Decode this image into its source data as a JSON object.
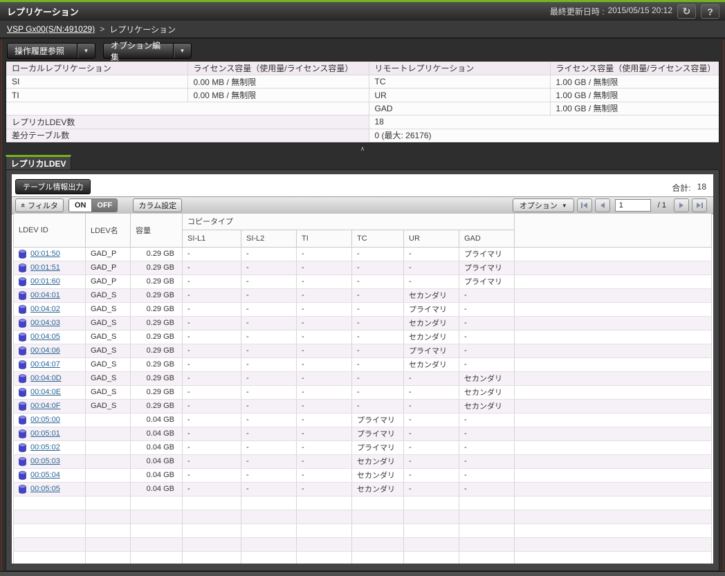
{
  "colors": {
    "accent_green": "#74b41e",
    "link_blue": "#2a6496",
    "alt_row": "#f6f1f6",
    "frame_maroon": "#553028"
  },
  "icons": {
    "refresh": "↻",
    "help": "?",
    "dropdown": "▼",
    "collapse": "∧",
    "filter": "«"
  },
  "header": {
    "title": "レプリケーション",
    "last_updated_label": "最終更新日時 :",
    "last_updated": "2015/05/15 20:12"
  },
  "breadcrumb": {
    "root": "VSP Gx00(S/N:491029)",
    "separator": ">",
    "current": "レプリケーション"
  },
  "actions": {
    "history_button": "操作履歴参照",
    "options_button": "オプション編集"
  },
  "summary": {
    "local_header": "ローカルレプリケーション",
    "local_license_header": "ライセンス容量（使用量/ライセンス容量）",
    "local_rows": [
      {
        "name": "SI",
        "license": "0.00 MB / 無制限"
      },
      {
        "name": "TI",
        "license": "0.00 MB / 無制限"
      }
    ],
    "remote_header": "リモートレプリケーション",
    "remote_license_header": "ライセンス容量（使用量/ライセンス容量）",
    "remote_rows": [
      {
        "name": "TC",
        "license": "1.00 GB / 無制限"
      },
      {
        "name": "UR",
        "license": "1.00 GB / 無制限"
      },
      {
        "name": "GAD",
        "license": "1.00 GB / 無制限"
      }
    ],
    "replica_ldev_label": "レプリカLDEV数",
    "replica_ldev_count": "18",
    "diff_table_label": "差分テーブル数",
    "diff_table_value": "0 (最大: 26176)"
  },
  "tab": {
    "label": "レプリカLDEV"
  },
  "table_panel": {
    "export_button": "テーブル情報出力",
    "total_label": "合計:",
    "total_value": "18",
    "filter_label": "フィルタ",
    "on_label": "ON",
    "off_label": "OFF",
    "column_settings_label": "カラム設定",
    "option_button": "オプション",
    "page": "1",
    "page_total": "/ 1"
  },
  "table": {
    "headers": {
      "ldev_id": "LDEV ID",
      "ldev_name": "LDEV名",
      "capacity": "容量",
      "copy_type_group": "コピータイプ",
      "sub": [
        "SI-L1",
        "SI-L2",
        "TI",
        "TC",
        "UR",
        "GAD"
      ]
    },
    "filler_rows": 5,
    "rows": [
      {
        "id": "00:01:50",
        "name": "GAD_P",
        "capacity": "0.29 GB",
        "copy": [
          "-",
          "-",
          "-",
          "-",
          "-",
          "プライマリ"
        ]
      },
      {
        "id": "00:01:51",
        "name": "GAD_P",
        "capacity": "0.29 GB",
        "copy": [
          "-",
          "-",
          "-",
          "-",
          "-",
          "プライマリ"
        ]
      },
      {
        "id": "00:01:60",
        "name": "GAD_P",
        "capacity": "0.29 GB",
        "copy": [
          "-",
          "-",
          "-",
          "-",
          "-",
          "プライマリ"
        ]
      },
      {
        "id": "00:04:01",
        "name": "GAD_S",
        "capacity": "0.29 GB",
        "copy": [
          "-",
          "-",
          "-",
          "-",
          "セカンダリ",
          "-"
        ]
      },
      {
        "id": "00:04:02",
        "name": "GAD_S",
        "capacity": "0.29 GB",
        "copy": [
          "-",
          "-",
          "-",
          "-",
          "プライマリ",
          "-"
        ]
      },
      {
        "id": "00:04:03",
        "name": "GAD_S",
        "capacity": "0.29 GB",
        "copy": [
          "-",
          "-",
          "-",
          "-",
          "セカンダリ",
          "-"
        ]
      },
      {
        "id": "00:04:05",
        "name": "GAD_S",
        "capacity": "0.29 GB",
        "copy": [
          "-",
          "-",
          "-",
          "-",
          "セカンダリ",
          "-"
        ]
      },
      {
        "id": "00:04:06",
        "name": "GAD_S",
        "capacity": "0.29 GB",
        "copy": [
          "-",
          "-",
          "-",
          "-",
          "プライマリ",
          "-"
        ]
      },
      {
        "id": "00:04:07",
        "name": "GAD_S",
        "capacity": "0.29 GB",
        "copy": [
          "-",
          "-",
          "-",
          "-",
          "セカンダリ",
          "-"
        ]
      },
      {
        "id": "00:04:0D",
        "name": "GAD_S",
        "capacity": "0.29 GB",
        "copy": [
          "-",
          "-",
          "-",
          "-",
          "-",
          "セカンダリ"
        ]
      },
      {
        "id": "00:04:0E",
        "name": "GAD_S",
        "capacity": "0.29 GB",
        "copy": [
          "-",
          "-",
          "-",
          "-",
          "-",
          "セカンダリ"
        ]
      },
      {
        "id": "00:04:0F",
        "name": "GAD_S",
        "capacity": "0.29 GB",
        "copy": [
          "-",
          "-",
          "-",
          "-",
          "-",
          "セカンダリ"
        ]
      },
      {
        "id": "00:05:00",
        "name": "",
        "capacity": "0.04 GB",
        "copy": [
          "-",
          "-",
          "-",
          "プライマリ",
          "-",
          "-"
        ]
      },
      {
        "id": "00:05:01",
        "name": "",
        "capacity": "0.04 GB",
        "copy": [
          "-",
          "-",
          "-",
          "プライマリ",
          "-",
          "-"
        ]
      },
      {
        "id": "00:05:02",
        "name": "",
        "capacity": "0.04 GB",
        "copy": [
          "-",
          "-",
          "-",
          "プライマリ",
          "-",
          "-"
        ]
      },
      {
        "id": "00:05:03",
        "name": "",
        "capacity": "0.04 GB",
        "copy": [
          "-",
          "-",
          "-",
          "セカンダリ",
          "-",
          "-"
        ]
      },
      {
        "id": "00:05:04",
        "name": "",
        "capacity": "0.04 GB",
        "copy": [
          "-",
          "-",
          "-",
          "セカンダリ",
          "-",
          "-"
        ]
      },
      {
        "id": "00:05:05",
        "name": "",
        "capacity": "0.04 GB",
        "copy": [
          "-",
          "-",
          "-",
          "セカンダリ",
          "-",
          "-"
        ]
      }
    ]
  }
}
